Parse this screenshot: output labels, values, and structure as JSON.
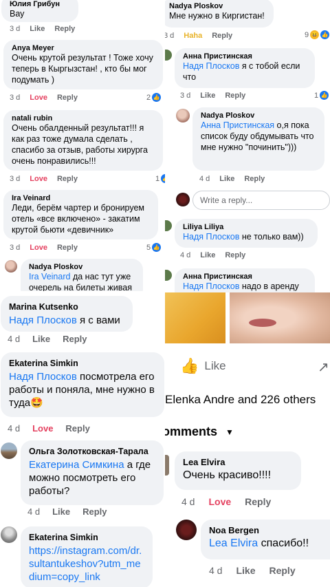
{
  "l1": {
    "name": "Юлия Грибун",
    "text": "Вау",
    "age": "3 d",
    "like": "Like",
    "reply": "Reply"
  },
  "l2": {
    "name": "Anya Meyer",
    "text": "Очень крутой результат ! Тоже хочу теперь в Кыргызстан! , кто бы мог подумать )",
    "age": "3 d",
    "react": "Love",
    "reply": "Reply",
    "count": "2"
  },
  "l3": {
    "name": "natali rubin",
    "text": "Очень обалденный результат!!! я как раз тоже думала сделать , спасибо за отзыв, работы хирурга очень понравились!!!",
    "age": "3 d",
    "react": "Love",
    "reply": "Reply",
    "count": "1"
  },
  "l4": {
    "name": "Ira Veinard",
    "text": "Леди, берём чартер и бронируем отель «все включено» - закатим крутой бьюти «девичник»",
    "age": "3 d",
    "react": "Love",
    "reply": "Reply",
    "count": "5"
  },
  "l5": {
    "name": "Nadya  Ploskov",
    "mention": "Ira Veinard",
    "text": " да нас тут уже очерель на билеты живая"
  },
  "r1": {
    "name": "Nadya  Ploskov",
    "text": "Мне нужно в Киргистан!",
    "age": "3 d",
    "react": "Haha",
    "reply": "Reply",
    "count": "9"
  },
  "r2": {
    "name": "Анна Пристинская",
    "mention": "Надя Плосков",
    "text": " я с тобой если что",
    "age": "3 d",
    "like": "Like",
    "reply": "Reply",
    "count": "1"
  },
  "r3": {
    "name": "Nadya  Ploskov",
    "mention": "Анна Пристинская",
    "text": " о,я пока список буду обдумывать что мне нужно \"починить\")))",
    "age": "4 d",
    "like": "Like",
    "reply": "Reply"
  },
  "r_input": {
    "placeholder": "Write a reply..."
  },
  "r4": {
    "name": "Liliya Liliya",
    "mention": "Надя Плосков",
    "text": " не только вам))",
    "age": "4 d",
    "like": "Like",
    "reply": "Reply"
  },
  "r5": {
    "name": "Анна Пристинская",
    "mention": "Надя Плосков",
    "text": " надо в аренду"
  },
  "m1": {
    "name": "Marina Kutsenko",
    "mention": "Надя Плосков",
    "text": " я с вами",
    "age": "4 d",
    "like": "Like",
    "reply": "Reply"
  },
  "m2": {
    "name": "Ekaterina Simkin",
    "mention": "Надя Плосков",
    "text": " посмотрела его работы и поняла, мне нужно в туда",
    "emoji": "🤩",
    "age": "4 d",
    "react": "Love",
    "reply": "Reply"
  },
  "m3": {
    "name": "Ольга Золотковская-Тарала",
    "mention": "Екатерина Симкина",
    "text": " а где можно посмотреть его работы?",
    "age": "4 d",
    "like": "Like",
    "reply": "Reply"
  },
  "m4": {
    "name": "Ekaterina Simkin",
    "link": "https://instagram.com/dr.sultantukeshov?utm_medium=copy_link"
  },
  "post": {
    "like": "Like",
    "reactors": "Elenka Andre and 226 others",
    "comments": "omments"
  },
  "p1": {
    "name": "Lea Elvira",
    "text": "Очень красиво!!!!",
    "age": "4 d",
    "react": "Love",
    "reply": "Reply"
  },
  "p2": {
    "name": "Noa Bergen",
    "mention": "Lea Elvira",
    "text": " спасибо!!",
    "age": "4 d",
    "like": "Like",
    "reply": "Reply"
  },
  "colors": {
    "mention": "#1877f2",
    "love": "#e4405f",
    "haha": "#e8b32a",
    "bubble": "#f0f2f5"
  }
}
